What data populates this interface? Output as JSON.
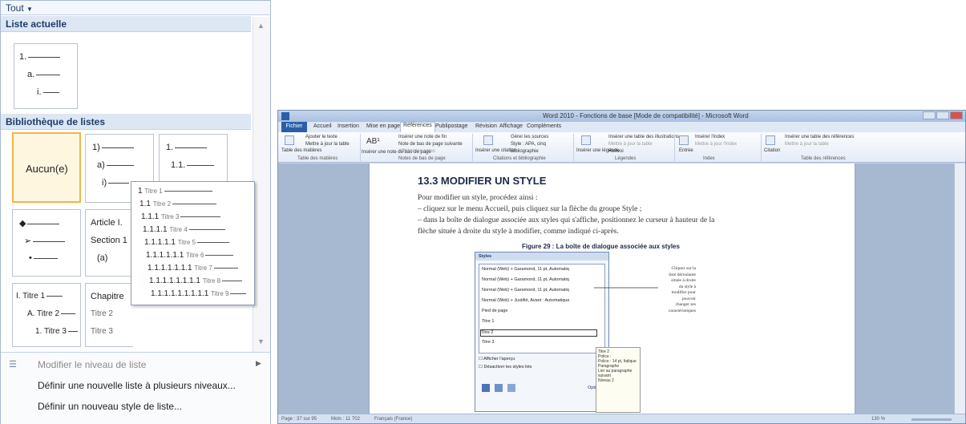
{
  "gallery": {
    "filter": "Tout",
    "section_current": "Liste actuelle",
    "section_library": "Bibliothèque de listes",
    "current_list": [
      "1.",
      "a.",
      "i."
    ],
    "none_label": "Aucun(e)",
    "cell_numbered_paren": [
      "1)",
      "a)",
      "i)"
    ],
    "cell_numbered_decimal": [
      "1.",
      "1.1."
    ],
    "cell_bullets": [
      "◆",
      "➢",
      "•"
    ],
    "cell_article": [
      "Article I.",
      "Section 1",
      "(a)"
    ],
    "cell_article_suffix": [
      "T",
      "",
      "Titre"
    ],
    "cell_titre": [
      "I. Titre 1",
      "A. Titre 2",
      "1. Titre 3"
    ],
    "cell_chapitre": [
      "Chapitre",
      "Titre 2",
      "Titre 3"
    ],
    "popup_lines": [
      {
        "num": "1",
        "label": "Titre 1"
      },
      {
        "num": "1.1",
        "label": "Titre 2"
      },
      {
        "num": "1.1.1",
        "label": "Titre 3"
      },
      {
        "num": "1.1.1.1",
        "label": "Titre 4"
      },
      {
        "num": "1.1.1.1.1",
        "label": "Titre 5"
      },
      {
        "num": "1.1.1.1.1.1",
        "label": "Titre 6"
      },
      {
        "num": "1.1.1.1.1.1.1",
        "label": "Titre 7"
      },
      {
        "num": "1.1.1.1.1.1.1.1",
        "label": "Titre 8"
      },
      {
        "num": "1.1.1.1.1.1.1.1.1",
        "label": "Titre 9"
      }
    ],
    "footer": {
      "change_level": "Modifier le niveau de liste",
      "define_multilevel": "Définir une nouvelle liste à plusieurs niveaux...",
      "define_style": "Définir un nouveau style de liste..."
    }
  },
  "word": {
    "title": "Word 2010 - Fonctions de base [Mode de compatibilité] - Microsoft Word",
    "tabs": [
      "Fichier",
      "Accueil",
      "Insertion",
      "Mise en page",
      "Références",
      "Publipostage",
      "Révision",
      "Affichage",
      "Compléments"
    ],
    "active_tab": "Références",
    "ribbon": {
      "toc": "Table des matières",
      "add_text": "Ajouter le texte",
      "update_table": "Mettre à jour la table",
      "insert_footnote": "Insérer une note de fin",
      "next_footnote": "Note de bas de page suivante",
      "show_notes": "Afficher les notes",
      "footnote_btn": "Insérer une note de bas de page",
      "insert_citation": "Insérer une citation",
      "manage_sources": "Gérer les sources",
      "style_apa": "Style : APA, cinq",
      "bibliography": "Bibliographie",
      "insert_caption": "Insérer une légende",
      "insert_table_figures": "Insérer une table des illustrations",
      "update_table2": "Mettre à jour la table",
      "cross_ref": "Renvoi",
      "mark_entry": "Entrée",
      "insert_index": "Insérer l'index",
      "update_index": "Mettre à jour l'index",
      "mark_citation": "Citation",
      "insert_toa": "Insérer une table des références",
      "update_toa": "Mettre à jour la table",
      "groups": [
        "Table des matières",
        "Notes de bas de page",
        "Citations et bibliographie",
        "Légendes",
        "Index",
        "Table des références"
      ]
    },
    "doc": {
      "heading": "13.3 MODIFIER UN STYLE",
      "p1": "Pour modifier un style, procédez ainsi :",
      "p2": "– cliquez sur le menu Accueil, puis cliquez sur la flèche du groupe Style ;",
      "p3": "– dans la boîte de dialogue associée aux styles qui s'affiche, positionnez le curseur à hauteur de la",
      "p4": "flèche située à droite du style à modifier, comme indiqué ci-après.",
      "figure_caption": "Figure 29 : La boîte de dialogue associée aux styles",
      "callout": [
        "Cliquez sur la",
        "liste déroulante",
        "située à droite",
        "du style à",
        "modifier pour",
        "pouvoir",
        "changer ses",
        "caractéristiques"
      ]
    },
    "styles_pane": {
      "title": "Styles",
      "items": [
        "Normal (Web) + Garamond, 11 pt, Automatiq",
        "Normal (Web) + Garamond, 11 pt, Automatiq",
        "Normal (Web) + Garamond, 11 pt, Automatiq",
        "Normal (Web) + Justifié, Avant : Automatique",
        "Pied de page",
        "Titre 1",
        "Titre 2",
        "Titre 3"
      ],
      "show_preview": "Afficher l'aperçu",
      "disable_linked": "Désactiver les styles liés",
      "options": "Options...",
      "tip": [
        "Titre 2",
        "Police :",
        "Police : 14 pt, Italique",
        "Paragraphe",
        "Lier au paragraphe suivant",
        "Niveau 2"
      ]
    },
    "status": {
      "page": "Page : 37 sur 95",
      "words": "Mots : 11 702",
      "lang": "Français (France)",
      "zoom": "130 %"
    }
  }
}
